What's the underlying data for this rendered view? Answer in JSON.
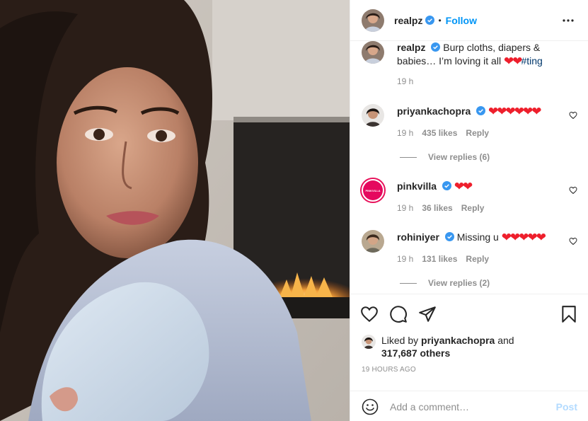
{
  "post": {
    "author": "realpz",
    "follow_label": "Follow",
    "separator": "•"
  },
  "caption": {
    "username": "realpz",
    "text": "Burp cloths, diapers & babies… I’m loving it all",
    "hearts": "❤❤",
    "hashtag": "#ting",
    "time": "19 h"
  },
  "comments": [
    {
      "username": "priyankachopra",
      "text": "",
      "hearts": "❤❤❤❤❤❤",
      "time": "19 h",
      "likes": "435 likes",
      "reply": "Reply",
      "view_replies": "View replies (6)"
    },
    {
      "username": "pinkvilla",
      "text": "",
      "hearts": "❤❤",
      "time": "19 h",
      "likes": "36 likes",
      "reply": "Reply",
      "avatar_text": "PINKVILLA"
    },
    {
      "username": "rohiniyer",
      "text": "Missing u ",
      "hearts": "❤❤❤❤❤",
      "time": "19 h",
      "likes": "131 likes",
      "reply": "Reply",
      "view_replies": "View replies (2)"
    }
  ],
  "likes": {
    "prefix": "Liked by ",
    "user": "priyankachopra",
    "middle": " and",
    "others": "317,687 others"
  },
  "timestamp": "19 HOURS AGO",
  "comment_box": {
    "placeholder": "Add a comment…",
    "post_label": "Post"
  },
  "colors": {
    "accent": "#0095f6",
    "heart": "#ee1f2c",
    "muted": "#8e8e8e",
    "post_disabled": "#b3dbff"
  },
  "icons": [
    "more-options-icon",
    "verified-icon",
    "like-icon",
    "comment-icon",
    "share-icon",
    "save-icon",
    "emoji-icon"
  ]
}
